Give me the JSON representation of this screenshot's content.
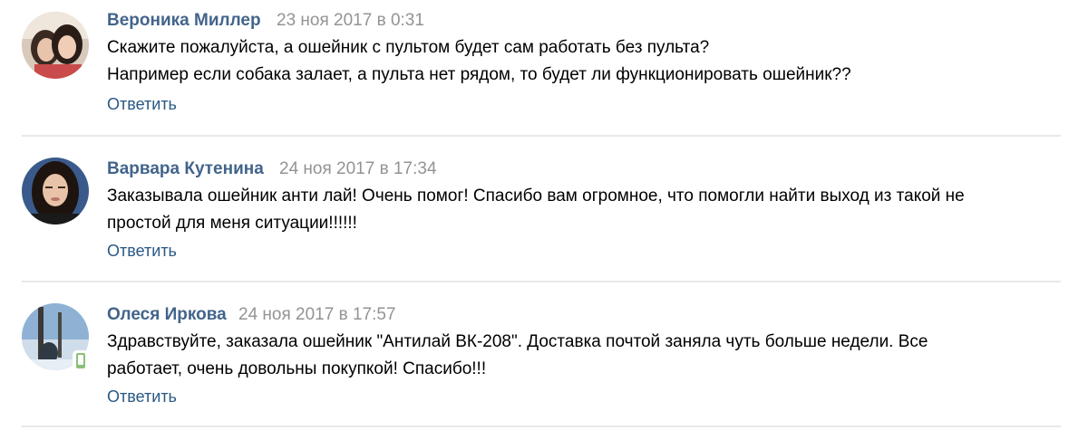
{
  "comments": [
    {
      "author": "Вероника Миллер",
      "date": "23 ноя 2017 в 0:31",
      "text_lines": [
        "Скажите пожалуйста, а ошейник с пультом будет сам работать без пульта?",
        "Например если собака залает, а пульта нет рядом, то будет ли функционировать ошейник??"
      ],
      "reply_label": "Ответить"
    },
    {
      "author": "Варвара Кутенина",
      "date": "24 ноя 2017 в 17:34",
      "text_lines": [
        "Заказывала ошейник анти лай! Очень помог! Спасибо вам огромное, что помогли найти выход из такой не",
        "простой для меня ситуации!!!!!!"
      ],
      "reply_label": "Ответить"
    },
    {
      "author": "Олеся Иркова",
      "date": "24 ноя 2017 в 17:57",
      "text_lines": [
        "Здравствуйте, заказала ошейник \"Антилай ВК-208\". Доставка почтой заняла чуть больше недели. Все",
        "работает, очень довольны покупкой! Спасибо!!!"
      ],
      "reply_label": "Ответить",
      "mobile_badge_icon": "mobile-phone-icon"
    }
  ],
  "colors": {
    "author": "#42648b",
    "date": "#939393",
    "text": "#000000",
    "reply": "#2a5885",
    "divider": "#e7e8ec",
    "mobile_badge": "#8ac176"
  }
}
